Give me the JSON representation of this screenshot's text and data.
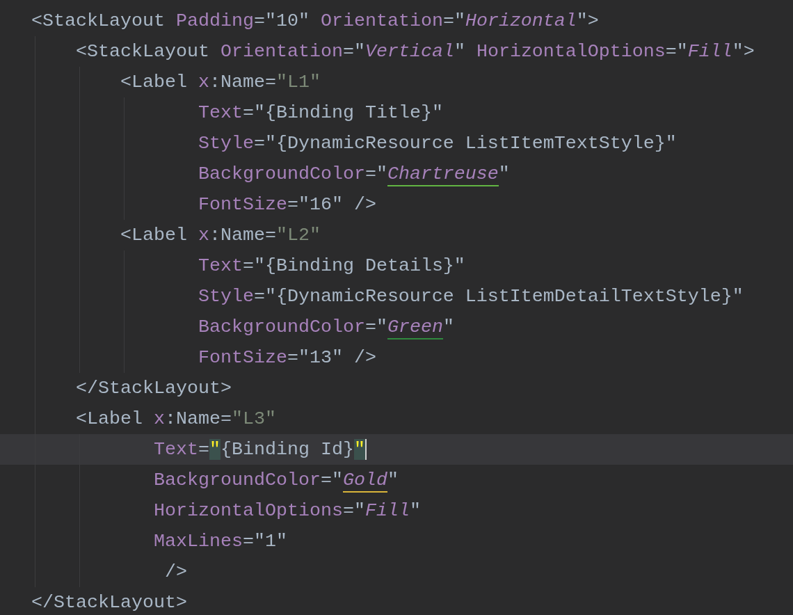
{
  "lines": [
    {
      "kind": "root",
      "current": false,
      "tokens": [
        {
          "kind": "tag",
          "text": "<StackLayout "
        },
        {
          "kind": "attr",
          "text": "Padding"
        },
        {
          "kind": "text",
          "text": "=\"10\" "
        },
        {
          "kind": "attr",
          "text": "Orientation"
        },
        {
          "kind": "text",
          "text": "=\""
        },
        {
          "kind": "enum",
          "text": "Horizontal"
        },
        {
          "kind": "text",
          "text": "\">"
        }
      ]
    },
    {
      "kind": "level1",
      "current": false,
      "tokens": [
        {
          "kind": "tag",
          "text": "<StackLayout "
        },
        {
          "kind": "attr",
          "text": "Orientation"
        },
        {
          "kind": "text",
          "text": "=\""
        },
        {
          "kind": "enum",
          "text": "Vertical"
        },
        {
          "kind": "text",
          "text": "\" "
        },
        {
          "kind": "attr",
          "text": "HorizontalOptions"
        },
        {
          "kind": "text",
          "text": "=\""
        },
        {
          "kind": "enum",
          "text": "Fill"
        },
        {
          "kind": "text",
          "text": "\">"
        }
      ]
    },
    {
      "kind": "level2",
      "current": false,
      "tokens": [
        {
          "kind": "tag",
          "text": "<Label "
        },
        {
          "kind": "attr",
          "text": "x"
        },
        {
          "kind": "text",
          "text": ":Name="
        },
        {
          "kind": "id",
          "text": "\"L1\""
        }
      ]
    },
    {
      "kind": "level2_attr",
      "current": false,
      "tokens": [
        {
          "kind": "attr",
          "text": "Text"
        },
        {
          "kind": "text",
          "text": "=\"{Binding Title}\""
        }
      ]
    },
    {
      "kind": "level2_attr",
      "current": false,
      "tokens": [
        {
          "kind": "attr",
          "text": "Style"
        },
        {
          "kind": "text",
          "text": "=\"{DynamicResource ListItemTextStyle}\""
        }
      ]
    },
    {
      "kind": "level2_attr",
      "current": false,
      "tokens": [
        {
          "kind": "attr",
          "text": "BackgroundColor"
        },
        {
          "kind": "text",
          "text": "=\""
        },
        {
          "kind": "enum",
          "text": "Chartreuse",
          "color": "#62b543"
        },
        {
          "kind": "text",
          "text": "\""
        }
      ]
    },
    {
      "kind": "level2_attr",
      "current": false,
      "tokens": [
        {
          "kind": "attr",
          "text": "FontSize"
        },
        {
          "kind": "text",
          "text": "=\"16\" />"
        }
      ]
    },
    {
      "kind": "level2",
      "current": false,
      "tokens": [
        {
          "kind": "tag",
          "text": "<Label "
        },
        {
          "kind": "attr",
          "text": "x"
        },
        {
          "kind": "text",
          "text": ":Name="
        },
        {
          "kind": "id",
          "text": "\"L2\""
        }
      ]
    },
    {
      "kind": "level2_attr",
      "current": false,
      "tokens": [
        {
          "kind": "attr",
          "text": "Text"
        },
        {
          "kind": "text",
          "text": "=\"{Binding Details}\""
        }
      ]
    },
    {
      "kind": "level2_attr",
      "current": false,
      "tokens": [
        {
          "kind": "attr",
          "text": "Style"
        },
        {
          "kind": "text",
          "text": "=\"{DynamicResource ListItemDetailTextStyle}\""
        }
      ]
    },
    {
      "kind": "level2_attr",
      "current": false,
      "tokens": [
        {
          "kind": "attr",
          "text": "BackgroundColor"
        },
        {
          "kind": "text",
          "text": "=\""
        },
        {
          "kind": "enum",
          "text": "Green",
          "color": "#2f8a3e"
        },
        {
          "kind": "text",
          "text": "\""
        }
      ]
    },
    {
      "kind": "level2_attr",
      "current": false,
      "tokens": [
        {
          "kind": "attr",
          "text": "FontSize"
        },
        {
          "kind": "text",
          "text": "=\"13\" />"
        }
      ]
    },
    {
      "kind": "level1",
      "current": false,
      "tokens": [
        {
          "kind": "tag",
          "text": "</StackLayout>"
        }
      ]
    },
    {
      "kind": "level1",
      "current": false,
      "tokens": [
        {
          "kind": "tag",
          "text": "<Label "
        },
        {
          "kind": "attr",
          "text": "x"
        },
        {
          "kind": "text",
          "text": ":Name="
        },
        {
          "kind": "id",
          "text": "\"L3\""
        }
      ]
    },
    {
      "kind": "level1_attr",
      "current": true,
      "tokens": [
        {
          "kind": "attr",
          "text": "Text"
        },
        {
          "kind": "text",
          "text": "="
        },
        {
          "kind": "match",
          "text": "\""
        },
        {
          "kind": "text",
          "text": "{Binding Id}"
        },
        {
          "kind": "match",
          "text": "\""
        }
      ]
    },
    {
      "kind": "level1_attr",
      "current": false,
      "tokens": [
        {
          "kind": "attr",
          "text": "BackgroundColor"
        },
        {
          "kind": "text",
          "text": "=\""
        },
        {
          "kind": "enum",
          "text": "Gold",
          "color": "#d8b43a"
        },
        {
          "kind": "text",
          "text": "\""
        }
      ]
    },
    {
      "kind": "level1_attr",
      "current": false,
      "tokens": [
        {
          "kind": "attr",
          "text": "HorizontalOptions"
        },
        {
          "kind": "text",
          "text": "=\""
        },
        {
          "kind": "enum",
          "text": "Fill"
        },
        {
          "kind": "text",
          "text": "\""
        }
      ]
    },
    {
      "kind": "level1_attr",
      "current": false,
      "tokens": [
        {
          "kind": "attr",
          "text": "MaxLines"
        },
        {
          "kind": "text",
          "text": "=\"1\""
        }
      ]
    },
    {
      "kind": "level1_close",
      "current": false,
      "tokens": [
        {
          "kind": "text",
          "text": "/>"
        }
      ]
    },
    {
      "kind": "root",
      "current": false,
      "tokens": [
        {
          "kind": "tag",
          "text": "</StackLayout>"
        }
      ]
    }
  ]
}
